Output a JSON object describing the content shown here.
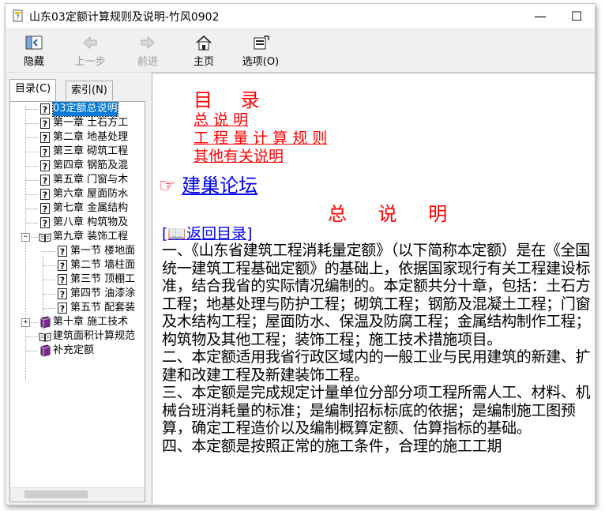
{
  "window": {
    "title": "山东03定额计算规则及说明-竹风0902",
    "minimize_glyph": "—",
    "maximize_glyph": "☐"
  },
  "toolbar": {
    "hide_label": "隐藏",
    "back_label": "上一步",
    "forward_label": "前进",
    "home_label": "主页",
    "options_label": "选项(O)"
  },
  "tabs": {
    "contents": "目录(C)",
    "index": "索引(N)"
  },
  "tree": {
    "items": [
      {
        "label": "03定额总说明",
        "icon": "help-page-icon",
        "selected": true
      },
      {
        "label": "第一章  土石方工",
        "icon": "help-page-icon"
      },
      {
        "label": "第二章  地基处理",
        "icon": "help-page-icon"
      },
      {
        "label": "第三章   砌筑工程",
        "icon": "help-page-icon"
      },
      {
        "label": "第四章  钢筋及混",
        "icon": "help-page-icon"
      },
      {
        "label": "第五章  门窗与木",
        "icon": "help-page-icon"
      },
      {
        "label": "第六章  屋面防水",
        "icon": "help-page-icon"
      },
      {
        "label": "第七章  金属结构",
        "icon": "help-page-icon"
      },
      {
        "label": "第八章  构筑物及",
        "icon": "help-page-icon"
      },
      {
        "label": "第九章    装饰工程",
        "icon": "open-book-icon"
      },
      {
        "label": "第一节  楼地面",
        "icon": "help-page-icon"
      },
      {
        "label": "第二节  墙柱面",
        "icon": "help-page-icon"
      },
      {
        "label": "第三节  顶棚工",
        "icon": "help-page-icon"
      },
      {
        "label": "第四节  油漆涂",
        "icon": "help-page-icon"
      },
      {
        "label": "第五节  配套装",
        "icon": "help-page-icon"
      },
      {
        "label": "第十章    施工技术",
        "icon": "closed-book-icon"
      },
      {
        "label": "建筑面积计算规范",
        "icon": "open-book-icon"
      },
      {
        "label": "补充定额",
        "icon": "closed-book-icon"
      }
    ],
    "collapse_glyph": "−",
    "expand_glyph": "+"
  },
  "content": {
    "toc_title": "目 录",
    "toc_links": [
      "总  说  明",
      "工 程 量 计 算 规 则",
      "其他有关说明"
    ],
    "forum_icon": "pointing-hand-icon",
    "forum_link": "建巢论坛",
    "heading": "总 说 明",
    "back_link": "[📖返回目录]",
    "paragraphs": [
      "一、《山东省建筑工程消耗量定额》（以下简称本定额）是在《全国统一建筑工程基础定额》的基础上，依据国家现行有关工程建设标准，结合我省的实际情况编制的。本定额共分十章，包括：土石方工程；地基处理与防护工程；砌筑工程；钢筋及混凝土工程；门窗及木结构工程；屋面防水、保温及防腐工程；金属结构制作工程；构筑物及其他工程；装饰工程；施工技术措施项目。",
      "二、本定额适用我省行政区域内的一般工业与民用建筑的新建、扩建和改建工程及新建装饰工程。",
      "三、本定额是完成规定计量单位分部分项工程所需人工、材料、机械台班消耗量的标准；是编制招标标底的依据；是编制施工图预算，确定工程造价以及编制概算定额、估算指标的基础。",
      "四、本定额是按照正常的施工条件，合理的施工工期"
    ]
  }
}
